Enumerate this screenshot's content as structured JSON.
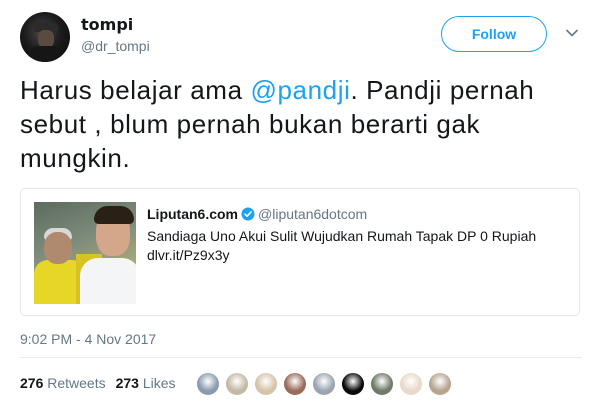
{
  "user": {
    "display_name": "tompi",
    "handle": "@dr_tompi"
  },
  "follow_button": {
    "label": "Follow"
  },
  "tweet": {
    "text_before": "Harus belajar ama  ",
    "mention": "@pandji",
    "text_after": ". Pandji pernah sebut , blum pernah bukan berarti gak mungkin."
  },
  "card": {
    "site": "Liputan6.com",
    "site_handle": "@liputan6dotcom",
    "title": "Sandiaga Uno Akui Sulit Wujudkan Rumah Tapak DP 0 Rupiah",
    "link": "dlvr.it/Pz9x3y"
  },
  "timestamp": "9:02 PM - 4 Nov 2017",
  "stats": {
    "retweets_count": "276",
    "retweets_label": "Retweets",
    "likes_count": "273",
    "likes_label": "Likes"
  },
  "colors": {
    "accent": "#1da1f2",
    "text": "#14171a",
    "muted": "#657786",
    "border": "#e1e8ed"
  },
  "icons": [
    "chevron-down-icon",
    "verified-badge-icon"
  ],
  "liker_avatars": [
    "#8a9bb0",
    "#c4b8a6",
    "#d7c3a9",
    "#9b6b5a",
    "#9aa5b1",
    "#0a0a0a",
    "#6f7a68",
    "#e8d9c8",
    "#b7a48f"
  ]
}
